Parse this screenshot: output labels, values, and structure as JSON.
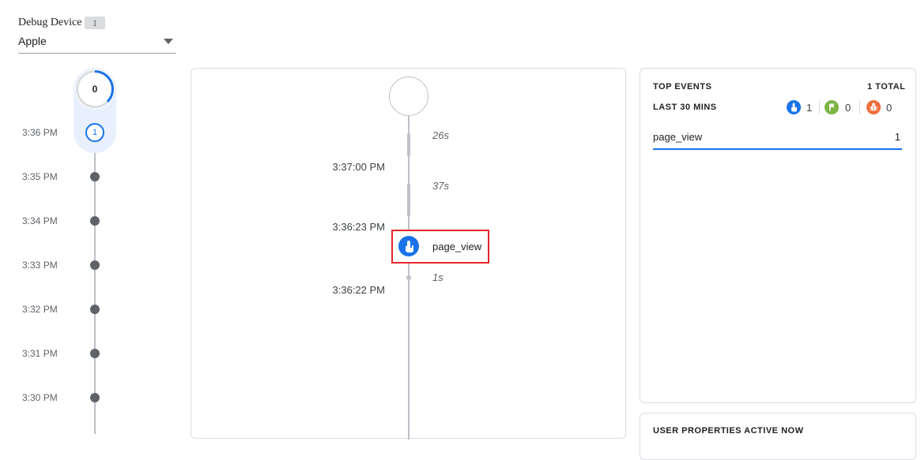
{
  "device": {
    "label": "Debug Device",
    "count": "1",
    "selected": "Apple"
  },
  "minutes": {
    "seconds_count": "0",
    "current_minute_count": "1",
    "labels": [
      "3:36 PM",
      "3:35 PM",
      "3:34 PM",
      "3:33 PM",
      "3:32 PM",
      "3:31 PM",
      "3:30 PM"
    ]
  },
  "stream": {
    "gaps": [
      "26s",
      "37s",
      "1s"
    ],
    "times": [
      "3:37:00 PM",
      "3:36:23 PM",
      "3:36:22 PM"
    ],
    "event": {
      "name": "page_view",
      "icon": "touch-icon"
    }
  },
  "top_events": {
    "title": "TOP EVENTS",
    "total": "1 TOTAL",
    "subtitle": "LAST 30 MINS",
    "type_counts": [
      {
        "icon": "touch-icon",
        "count": "1",
        "color": "#1a73e8"
      },
      {
        "icon": "flag-icon",
        "count": "0",
        "color": "#7cb342"
      },
      {
        "icon": "bug-icon",
        "count": "0",
        "color": "#ef6c3a"
      }
    ],
    "rows": [
      {
        "name": "page_view",
        "count": "1"
      }
    ]
  },
  "user_properties": {
    "title": "USER PROPERTIES ACTIVE NOW"
  },
  "colors": {
    "accent": "#1a73e8",
    "highlight_box": "#e8252b"
  }
}
